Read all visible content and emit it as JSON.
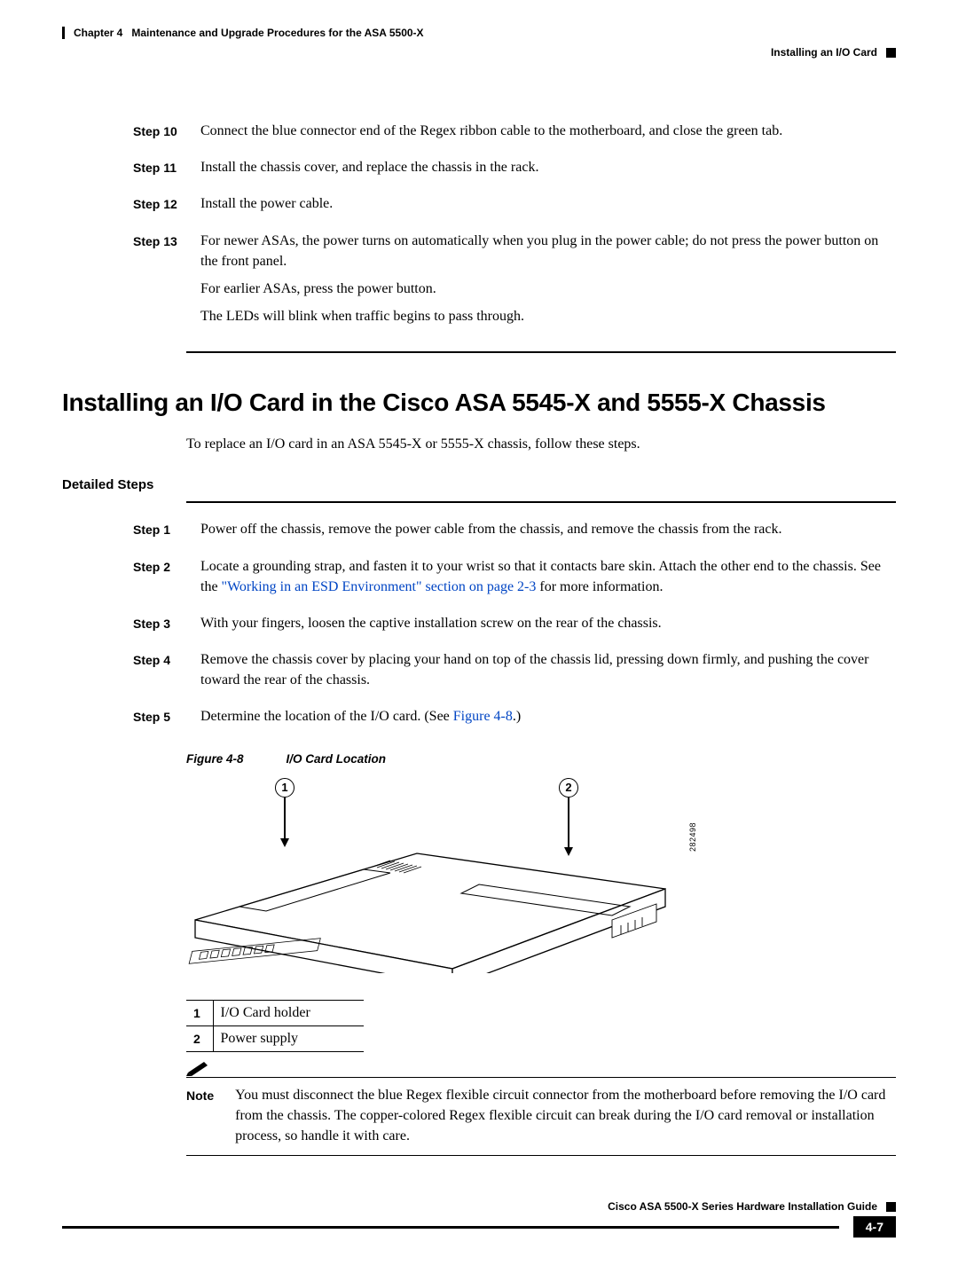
{
  "header": {
    "chapter_label": "Chapter 4",
    "chapter_title": "Maintenance and Upgrade Procedures for the ASA 5500-X",
    "section_name": "Installing an I/O Card"
  },
  "top_steps": [
    {
      "label": "Step 10",
      "paras": [
        "Connect the blue connector end of the Regex ribbon cable to the motherboard, and close the green tab."
      ]
    },
    {
      "label": "Step 11",
      "paras": [
        "Install the chassis cover, and replace the chassis in the rack."
      ]
    },
    {
      "label": "Step 12",
      "paras": [
        "Install the power cable."
      ]
    },
    {
      "label": "Step 13",
      "paras": [
        "For newer ASAs, the power turns on automatically when you plug in the power cable; do not press the power button on the front panel.",
        "For earlier ASAs, press the power button.",
        "The LEDs will blink when traffic begins to pass through."
      ]
    }
  ],
  "heading": "Installing an I/O Card in the Cisco ASA 5545-X and 5555-X Chassis",
  "intro": "To replace an I/O card in an ASA 5545-X or 5555-X chassis, follow these steps.",
  "detailed_label": "Detailed Steps",
  "detailed_steps": [
    {
      "label": "Step 1",
      "text_before": "Power off the chassis, remove the power cable from the chassis, and remove the chassis from the rack.",
      "link": "",
      "text_after": ""
    },
    {
      "label": "Step 2",
      "text_before": "Locate a grounding strap, and fasten it to your wrist so that it contacts bare skin. Attach the other end to the chassis. See the ",
      "link": "\"Working in an ESD Environment\" section on page 2-3",
      "text_after": " for more information."
    },
    {
      "label": "Step 3",
      "text_before": "With your fingers, loosen the captive installation screw on the rear of the chassis.",
      "link": "",
      "text_after": ""
    },
    {
      "label": "Step 4",
      "text_before": "Remove the chassis cover by placing your hand on top of the chassis lid, pressing down firmly, and pushing the cover toward the rear of the chassis.",
      "link": "",
      "text_after": ""
    },
    {
      "label": "Step 5",
      "text_before": "Determine the location of the I/O card. (See ",
      "link": "Figure 4-8",
      "text_after": ".)"
    }
  ],
  "figure": {
    "number": "Figure 4-8",
    "title": "I/O Card Location",
    "callouts": [
      "1",
      "2"
    ],
    "image_id": "282498"
  },
  "legend": [
    {
      "num": "1",
      "label": "I/O Card holder"
    },
    {
      "num": "2",
      "label": "Power supply"
    }
  ],
  "note": {
    "label": "Note",
    "text": "You must disconnect the blue Regex flexible circuit connector from the motherboard before removing the I/O card from the chassis. The copper-colored Regex flexible circuit can break during the I/O card removal or installation process, so handle it with care."
  },
  "footer": {
    "doc_title": "Cisco ASA 5500-X Series Hardware Installation Guide",
    "page_num": "4-7"
  }
}
